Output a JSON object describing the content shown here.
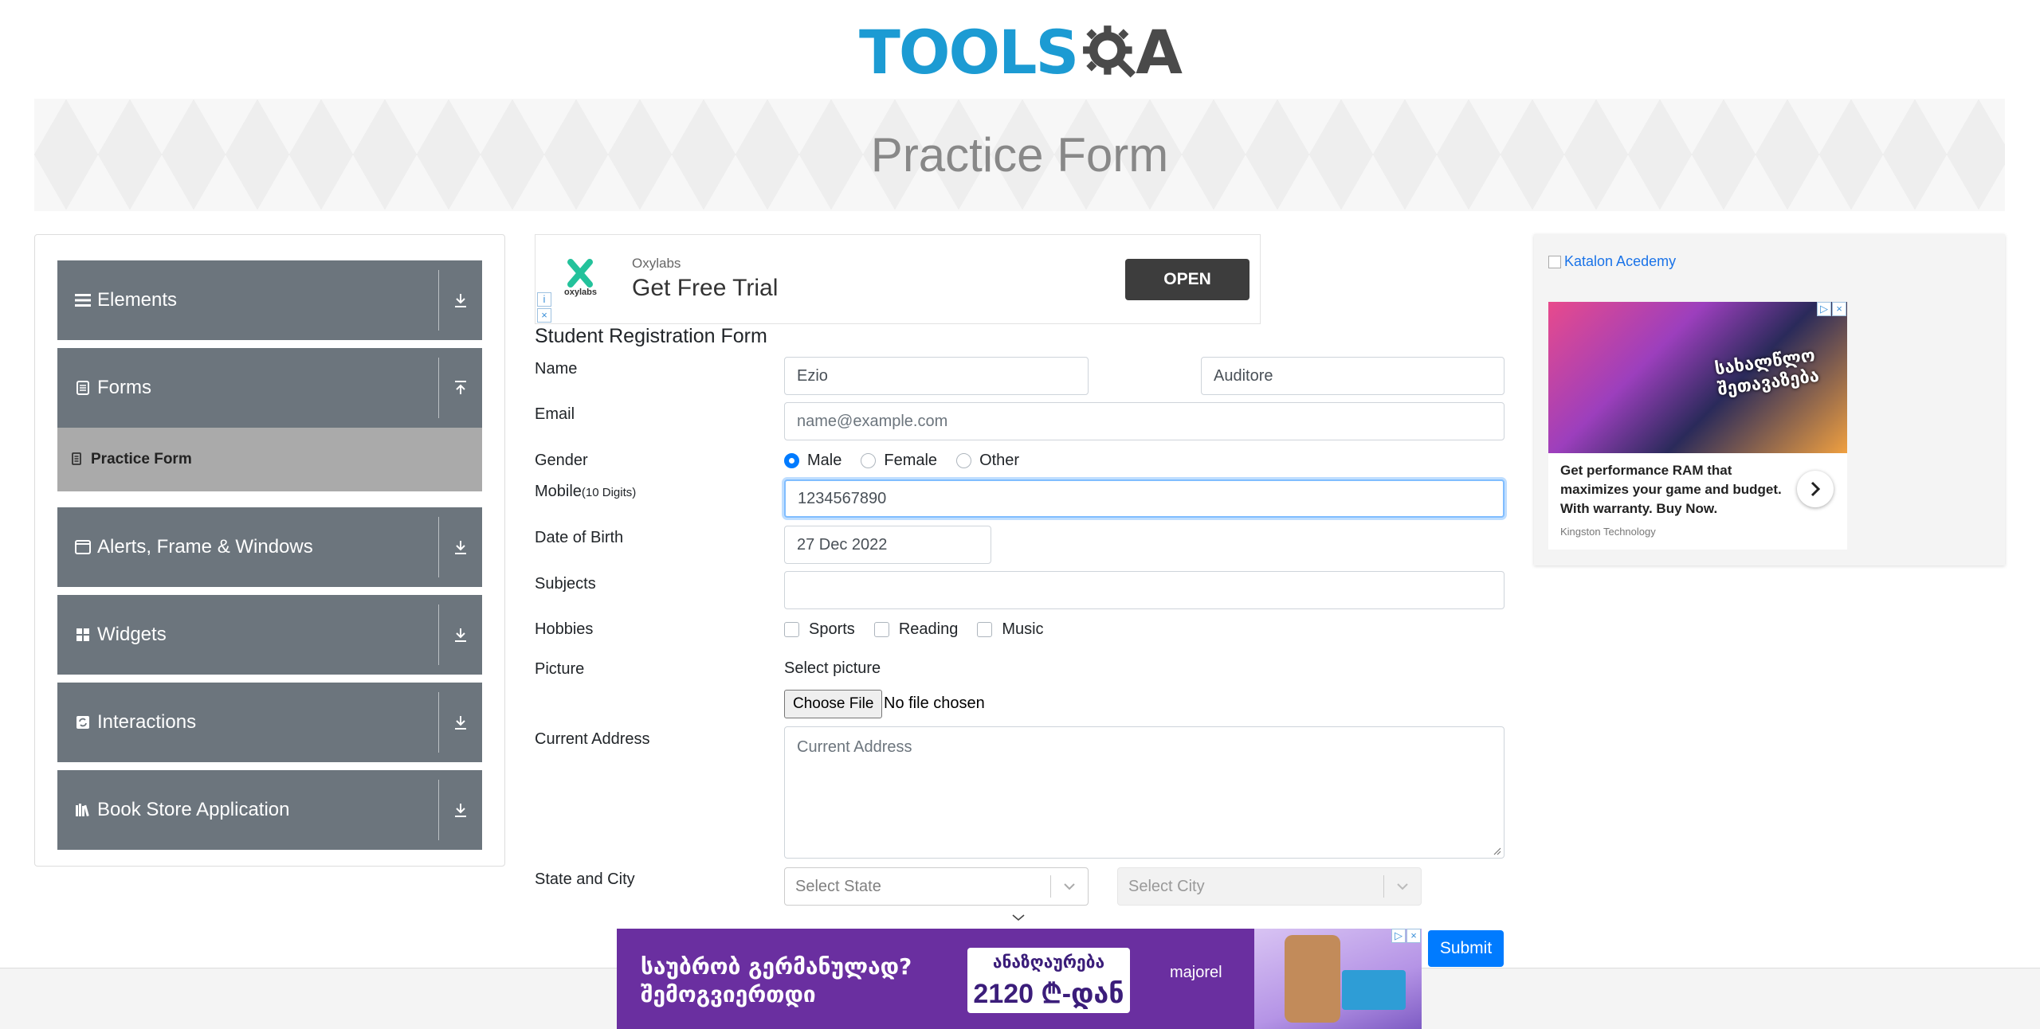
{
  "logo": {
    "text_left": "TOOLS",
    "text_right": "A",
    "colors": {
      "blue": "#1c9bd3",
      "gray": "#4a4a4a"
    }
  },
  "banner": {
    "title": "Practice Form"
  },
  "sidebar": {
    "groups": [
      {
        "label": "Elements",
        "icon": "hamburger-icon",
        "expanded": false
      },
      {
        "label": "Forms",
        "icon": "document-icon",
        "expanded": true,
        "items": [
          {
            "label": "Practice Form",
            "icon": "form-icon",
            "active": true
          }
        ]
      },
      {
        "label": "Alerts, Frame & Windows",
        "icon": "window-icon",
        "expanded": false
      },
      {
        "label": "Widgets",
        "icon": "grid-icon",
        "expanded": false
      },
      {
        "label": "Interactions",
        "icon": "refresh-icon",
        "expanded": false
      },
      {
        "label": "Book Store Application",
        "icon": "books-icon",
        "expanded": false
      }
    ]
  },
  "ad_top": {
    "brand_mini": "oxylabs",
    "brand": "Oxylabs",
    "headline": "Get Free Trial",
    "cta": "OPEN",
    "accent": "#23c29b"
  },
  "form": {
    "title": "Student Registration Form",
    "name": {
      "label": "Name",
      "first_value": "Ezio",
      "last_value": "Auditore"
    },
    "email": {
      "label": "Email",
      "placeholder": "name@example.com"
    },
    "gender": {
      "label": "Gender",
      "options": [
        "Male",
        "Female",
        "Other"
      ],
      "selected": "Male"
    },
    "mobile": {
      "label": "Mobile",
      "hint": "(10 Digits)",
      "value": "1234567890"
    },
    "dob": {
      "label": "Date of Birth",
      "value": "27 Dec 2022"
    },
    "subjects": {
      "label": "Subjects",
      "value": ""
    },
    "hobbies": {
      "label": "Hobbies",
      "options": [
        "Sports",
        "Reading",
        "Music"
      ]
    },
    "picture": {
      "label": "Picture",
      "select_text": "Select picture",
      "button": "Choose File",
      "status": "No file chosen"
    },
    "address": {
      "label": "Current Address",
      "placeholder": "Current Address"
    },
    "state_city": {
      "label": "State and City",
      "state_placeholder": "Select State",
      "city_placeholder": "Select City"
    },
    "submit": "Submit",
    "accent": "#007bff"
  },
  "ad_right": {
    "link_text": "Katalon Acedemy",
    "body": "Get performance RAM that maximizes your game and budget. With warranty. Buy Now.",
    "advertiser": "Kingston Technology",
    "photo_text": "სახალწლო შეთავაზება"
  },
  "ad_bottom": {
    "line1": "საუბრობ გერმანულად?",
    "line2": "შემოგვიერთდი",
    "price_top": "ანაზღაურება",
    "price_main": "2120 ₾-დან",
    "brand": "majorel"
  }
}
